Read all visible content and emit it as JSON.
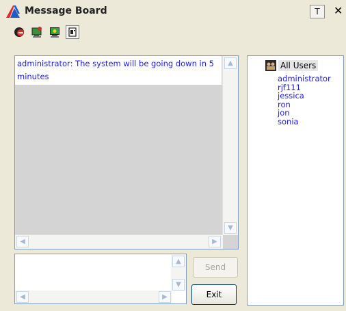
{
  "window": {
    "title": "Message Board",
    "pin_button_label": "T",
    "close_label": "✕"
  },
  "toolbar": {
    "tools": [
      {
        "icon": "do-not-disturb-icon"
      },
      {
        "icon": "user-computer-icon"
      },
      {
        "icon": "broadcast-computer-icon"
      },
      {
        "icon": "view-list-icon"
      }
    ]
  },
  "messages": [
    {
      "text": "administrator: The system will be going down in 5 minutes"
    }
  ],
  "composer": {
    "send_label": "Send",
    "exit_label": "Exit"
  },
  "users": {
    "root_label": "All Users",
    "list": [
      "administrator",
      "rjf111",
      "jessica",
      "ron",
      "jon",
      "sonia"
    ]
  },
  "colors": {
    "message_text": "#1a1aff",
    "user_text": "#1a1aff",
    "panel_border": "#7f9db9",
    "window_bg": "#ece9d8"
  }
}
